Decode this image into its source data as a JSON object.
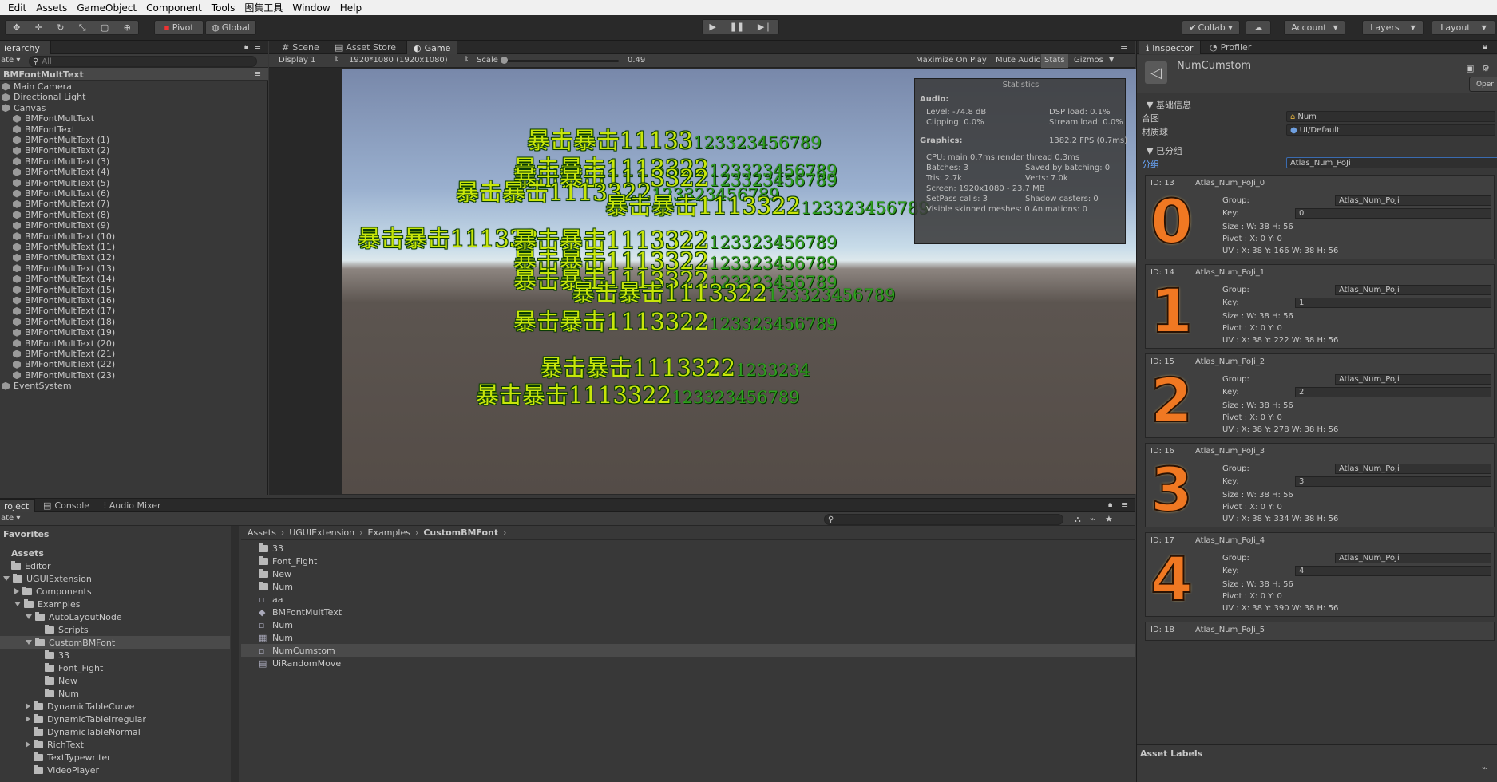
{
  "menu": [
    "Edit",
    "Assets",
    "GameObject",
    "Component",
    "Tools",
    "图集工具",
    "Window",
    "Help"
  ],
  "toolbar": {
    "pivot": "Pivot",
    "global": "Global",
    "collab": "Collab ▾",
    "account": "Account",
    "layers": "Layers",
    "layout": "Layout"
  },
  "hierarchy": {
    "tab": "ierarchy",
    "create": "ate ▾",
    "search_placeholder": "All",
    "scene": "BMFontMultText",
    "items": [
      {
        "label": "Main Camera",
        "indent": 0,
        "arrow": false
      },
      {
        "label": "Directional Light",
        "indent": 0,
        "arrow": false
      },
      {
        "label": "Canvas",
        "indent": 0,
        "arrow": true
      },
      {
        "label": "BMFontMultText",
        "indent": 1,
        "arrow": false
      },
      {
        "label": "BMFontText",
        "indent": 1,
        "arrow": false
      },
      {
        "label": "BMFontMultText (1)",
        "indent": 1,
        "arrow": false
      },
      {
        "label": "BMFontMultText (2)",
        "indent": 1,
        "arrow": false
      },
      {
        "label": "BMFontMultText (3)",
        "indent": 1,
        "arrow": false
      },
      {
        "label": "BMFontMultText (4)",
        "indent": 1,
        "arrow": false
      },
      {
        "label": "BMFontMultText (5)",
        "indent": 1,
        "arrow": false
      },
      {
        "label": "BMFontMultText (6)",
        "indent": 1,
        "arrow": false
      },
      {
        "label": "BMFontMultText (7)",
        "indent": 1,
        "arrow": false
      },
      {
        "label": "BMFontMultText (8)",
        "indent": 1,
        "arrow": false
      },
      {
        "label": "BMFontMultText (9)",
        "indent": 1,
        "arrow": false
      },
      {
        "label": "BMFontMultText (10)",
        "indent": 1,
        "arrow": false
      },
      {
        "label": "BMFontMultText (11)",
        "indent": 1,
        "arrow": false
      },
      {
        "label": "BMFontMultText (12)",
        "indent": 1,
        "arrow": false
      },
      {
        "label": "BMFontMultText (13)",
        "indent": 1,
        "arrow": false
      },
      {
        "label": "BMFontMultText (14)",
        "indent": 1,
        "arrow": false
      },
      {
        "label": "BMFontMultText (15)",
        "indent": 1,
        "arrow": false
      },
      {
        "label": "BMFontMultText (16)",
        "indent": 1,
        "arrow": false
      },
      {
        "label": "BMFontMultText (17)",
        "indent": 1,
        "arrow": false
      },
      {
        "label": "BMFontMultText (18)",
        "indent": 1,
        "arrow": false
      },
      {
        "label": "BMFontMultText (19)",
        "indent": 1,
        "arrow": false
      },
      {
        "label": "BMFontMultText (20)",
        "indent": 1,
        "arrow": false
      },
      {
        "label": "BMFontMultText (21)",
        "indent": 1,
        "arrow": false
      },
      {
        "label": "BMFontMultText (22)",
        "indent": 1,
        "arrow": false
      },
      {
        "label": "BMFontMultText (23)",
        "indent": 1,
        "arrow": false
      },
      {
        "label": "EventSystem",
        "indent": 0,
        "arrow": false
      }
    ]
  },
  "center_tabs": [
    "Scene",
    "Asset Store",
    "Game"
  ],
  "game_bar": {
    "display": "Display 1",
    "resolution": "1920*1080 (1920x1080)",
    "scale_label": "Scale",
    "scale_value": "0.49",
    "scale_fraction": 0.0,
    "maximize": "Maximize On Play",
    "mute": "Mute Audio",
    "stats": "Stats",
    "gizmos": "Gizmos"
  },
  "game_texts": [
    {
      "big": "暴击暴击11133",
      "small": "123323456789"
    },
    {
      "big": "暴击暴击1113322",
      "small": "123323456789"
    },
    {
      "big": "暴击暴击1113322",
      "small": "123323456789"
    },
    {
      "big": "暴击暴击1113322",
      "small": "123323456789"
    },
    {
      "big": "暴击暴击1113322",
      "small": "123323456789"
    },
    {
      "big": "暴击暴击111332",
      "small": ""
    },
    {
      "big": "暴击暴击1113322",
      "small": "123323456789"
    },
    {
      "big": "暴击暴击1113322",
      "small": "123323456789"
    },
    {
      "big": "暴击暴击1113322",
      "small": "123323456789"
    },
    {
      "big": "暴击暴击1113322",
      "small": "123323456789"
    },
    {
      "big": "暴击暴击1113322",
      "small": "123323456789"
    },
    {
      "big": "暴击暴击1113322",
      "small": "1233234"
    },
    {
      "big": "暴击暴击1113322",
      "small": "123323456789"
    }
  ],
  "statistics": {
    "title": "Statistics",
    "audio": "Audio:",
    "level": "Level: -74.8 dB",
    "dsp": "DSP load: 0.1%",
    "clipping": "Clipping: 0.0%",
    "stream": "Stream load: 0.0%",
    "graphics": "Graphics:",
    "fps": "1382.2 FPS (0.7ms)",
    "cpu": "CPU: main 0.7ms  render thread 0.3ms",
    "batches": "Batches: 3",
    "saved": "Saved by batching: 0",
    "tris": "Tris: 2.7k",
    "verts": "Verts: 7.0k",
    "screen": "Screen: 1920x1080 - 23.7 MB",
    "setpass": "SetPass calls: 3",
    "shadow": "Shadow casters: 0",
    "skinned": "Visible skinned meshes: 0  Animations: 0"
  },
  "inspector": {
    "tabs": [
      "Inspector",
      "Profiler"
    ],
    "object_name": "NumCumstom",
    "open": "Oper",
    "basic_section": "基础信息",
    "atlas_label": "合图",
    "atlas_value": "Num",
    "material_label": "材质球",
    "material_value": "UI/Default",
    "group_section": "已分组",
    "group_label": "分组",
    "group_value": "Atlas_Num_PoJi",
    "entries": [
      {
        "id": "ID: 13",
        "name": "Atlas_Num_PoJi_0",
        "digit": "0",
        "group": "Atlas_Num_PoJi",
        "key": "0",
        "size": "Size  : W: 38    H: 56",
        "pivot": "Pivot : X: 0     Y: 0",
        "uv": "UV   : X: 38  Y: 166  W: 38  H: 56"
      },
      {
        "id": "ID: 14",
        "name": "Atlas_Num_PoJi_1",
        "digit": "1",
        "group": "Atlas_Num_PoJi",
        "key": "1",
        "size": "Size  : W: 38    H: 56",
        "pivot": "Pivot : X: 0     Y: 0",
        "uv": "UV   : X: 38  Y: 222  W: 38  H: 56"
      },
      {
        "id": "ID: 15",
        "name": "Atlas_Num_PoJi_2",
        "digit": "2",
        "group": "Atlas_Num_PoJi",
        "key": "2",
        "size": "Size  : W: 38    H: 56",
        "pivot": "Pivot : X: 0     Y: 0",
        "uv": "UV   : X: 38  Y: 278  W: 38  H: 56"
      },
      {
        "id": "ID: 16",
        "name": "Atlas_Num_PoJi_3",
        "digit": "3",
        "group": "Atlas_Num_PoJi",
        "key": "3",
        "size": "Size  : W: 38    H: 56",
        "pivot": "Pivot : X: 0     Y: 0",
        "uv": "UV   : X: 38  Y: 334  W: 38  H: 56"
      },
      {
        "id": "ID: 17",
        "name": "Atlas_Num_PoJi_4",
        "digit": "4",
        "group": "Atlas_Num_PoJi",
        "key": "4",
        "size": "Size  : W: 38    H: 56",
        "pivot": "Pivot : X: 0     Y: 0",
        "uv": "UV   : X: 38  Y: 390  W: 38  H: 56"
      }
    ],
    "partial_entry": {
      "id": "ID: 18",
      "name": "Atlas_Num_PoJi_5"
    },
    "group_field_label": "Group:",
    "key_field_label": "Key:",
    "asset_labels": "Asset Labels"
  },
  "project": {
    "tabs": [
      "roject",
      "Console",
      "Audio Mixer"
    ],
    "create": "ate ▾",
    "favorites": "Favorites",
    "tree": [
      {
        "label": "Assets",
        "kind": "header",
        "indent": 0,
        "arrow": "none"
      },
      {
        "label": "Editor",
        "kind": "folder",
        "indent": 0,
        "arrow": "none"
      },
      {
        "label": "UGUIExtension",
        "kind": "folder",
        "indent": 0,
        "arrow": "down"
      },
      {
        "label": "Components",
        "kind": "folder",
        "indent": 1,
        "arrow": "right"
      },
      {
        "label": "Examples",
        "kind": "folder",
        "indent": 1,
        "arrow": "down"
      },
      {
        "label": "AutoLayoutNode",
        "kind": "folder",
        "indent": 2,
        "arrow": "down"
      },
      {
        "label": "Scripts",
        "kind": "folder",
        "indent": 3,
        "arrow": "none"
      },
      {
        "label": "CustomBMFont",
        "kind": "folder",
        "indent": 2,
        "arrow": "down",
        "selected": true
      },
      {
        "label": "33",
        "kind": "folder",
        "indent": 3,
        "arrow": "none"
      },
      {
        "label": "Font_Fight",
        "kind": "folder",
        "indent": 3,
        "arrow": "none"
      },
      {
        "label": "New",
        "kind": "folder",
        "indent": 3,
        "arrow": "none"
      },
      {
        "label": "Num",
        "kind": "folder",
        "indent": 3,
        "arrow": "none"
      },
      {
        "label": "DynamicTableCurve",
        "kind": "folder",
        "indent": 2,
        "arrow": "right"
      },
      {
        "label": "DynamicTableIrregular",
        "kind": "folder",
        "indent": 2,
        "arrow": "right"
      },
      {
        "label": "DynamicTableNormal",
        "kind": "folder",
        "indent": 2,
        "arrow": "none"
      },
      {
        "label": "RichText",
        "kind": "folder",
        "indent": 2,
        "arrow": "right"
      },
      {
        "label": "TextTypewriter",
        "kind": "folder",
        "indent": 2,
        "arrow": "none"
      },
      {
        "label": "VideoPlayer",
        "kind": "folder",
        "indent": 2,
        "arrow": "none"
      }
    ],
    "breadcrumb": [
      "Assets",
      "UGUIExtension",
      "Examples",
      "CustomBMFont"
    ],
    "files": [
      {
        "label": "33",
        "icon": "folder"
      },
      {
        "label": "Font_Fight",
        "icon": "folder"
      },
      {
        "label": "New",
        "icon": "folder"
      },
      {
        "label": "Num",
        "icon": "folder"
      },
      {
        "label": "aa",
        "icon": "asset"
      },
      {
        "label": "BMFontMultText",
        "icon": "unity"
      },
      {
        "label": "Num",
        "icon": "asset"
      },
      {
        "label": "Num",
        "icon": "sprite"
      },
      {
        "label": "NumCumstom",
        "icon": "asset",
        "selected": true
      },
      {
        "label": "UiRandomMove",
        "icon": "script"
      }
    ]
  }
}
